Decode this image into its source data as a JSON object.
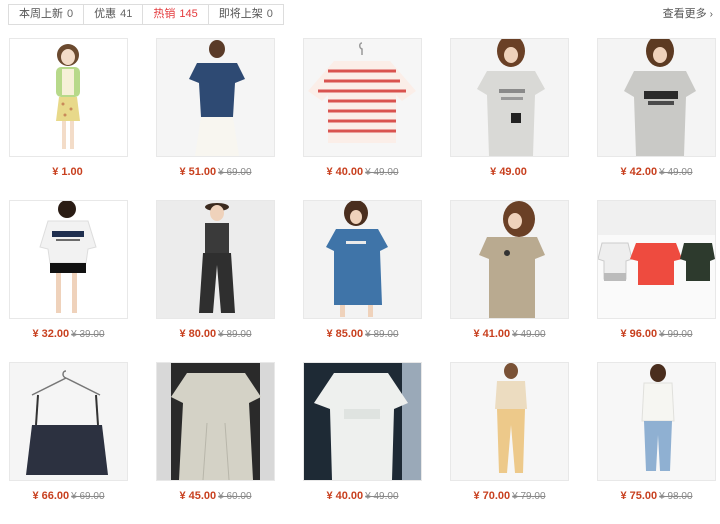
{
  "tabs": [
    {
      "label": "本周上新",
      "count": "0"
    },
    {
      "label": "优惠",
      "count": "41"
    },
    {
      "label": "热销",
      "count": "145",
      "active": true
    },
    {
      "label": "即将上架",
      "count": "0"
    }
  ],
  "more": {
    "label": "查看更多"
  },
  "colors": {
    "accent": "#e4393c",
    "price": "#c8401f"
  },
  "products": [
    {
      "price": "¥ 1.00",
      "old": ""
    },
    {
      "price": "¥ 51.00",
      "old": "¥ 69.00"
    },
    {
      "price": "¥ 40.00",
      "old": "¥ 49.00"
    },
    {
      "price": "¥ 49.00",
      "old": ""
    },
    {
      "price": "¥ 42.00",
      "old": "¥ 49.00"
    },
    {
      "price": "¥ 32.00",
      "old": "¥ 39.00"
    },
    {
      "price": "¥ 80.00",
      "old": "¥ 89.00"
    },
    {
      "price": "¥ 85.00",
      "old": "¥ 89.00"
    },
    {
      "price": "¥ 41.00",
      "old": "¥ 49.00"
    },
    {
      "price": "¥ 96.00",
      "old": "¥ 99.00"
    },
    {
      "price": "¥ 66.00",
      "old": "¥ 69.00"
    },
    {
      "price": "¥ 45.00",
      "old": "¥ 60.00"
    },
    {
      "price": "¥ 40.00",
      "old": "¥ 49.00"
    },
    {
      "price": "¥ 70.00",
      "old": "¥ 79.00"
    },
    {
      "price": "¥ 75.00",
      "old": "¥ 98.00"
    }
  ]
}
